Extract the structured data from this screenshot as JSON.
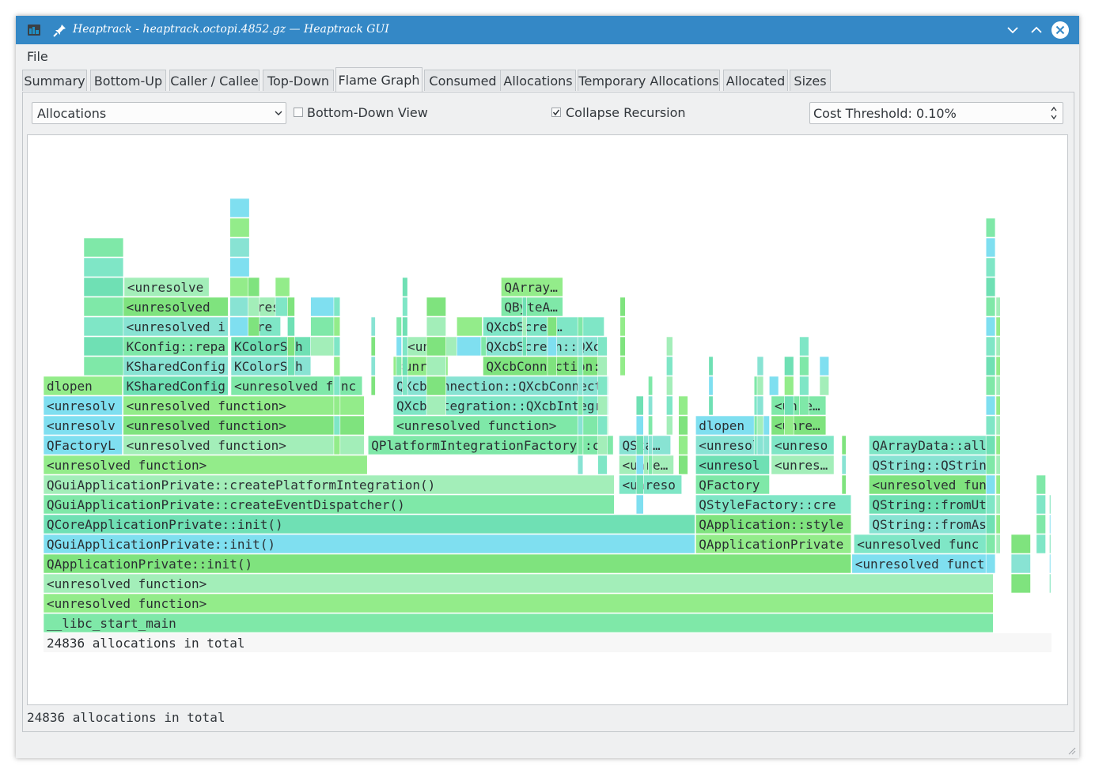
{
  "window": {
    "title": "Heaptrack - heaptrack.octopi.4852.gz — Heaptrack GUI"
  },
  "menu": {
    "file": "File"
  },
  "tabs": [
    {
      "label": "Summary"
    },
    {
      "label": "Bottom-Up"
    },
    {
      "label": "Caller / Callee"
    },
    {
      "label": "Top-Down"
    },
    {
      "label": "Flame Graph",
      "active": true
    },
    {
      "label": "Consumed"
    },
    {
      "label": "Allocations"
    },
    {
      "label": "Temporary Allocations"
    },
    {
      "label": "Allocated"
    },
    {
      "label": "Sizes"
    }
  ],
  "toolbar": {
    "cost_type": "Allocations",
    "bottom_down_label": "Bottom-Down View",
    "bottom_down_checked": false,
    "collapse_label": "Collapse Recursion",
    "collapse_checked": true,
    "threshold": "Cost Threshold: 0.10%"
  },
  "flamegraph": {
    "total_label": "24836 allocations in total",
    "frames": [
      {
        "label": "__libc_start_main",
        "share": 0.943
      },
      {
        "label": "<unresolved function>",
        "share": 0.943
      },
      {
        "label": "<unresolved function>",
        "share": 0.943
      },
      {
        "label": "QApplicationPrivate::init()",
        "share": 0.802
      },
      {
        "label": "QGuiApplicationPrivate::init()",
        "share": 0.647
      },
      {
        "label": "QCoreApplicationPrivate::init()",
        "share": 0.647
      },
      {
        "label": "QGuiApplicationPrivate::createEventDispatcher()",
        "share": 0.567
      },
      {
        "label": "QGuiApplicationPrivate::createPlatformIntegration()",
        "share": 0.567
      },
      {
        "label": "<unresolved function>",
        "share": 0.322
      },
      {
        "label": "QPlatformIntegrationFactory::create",
        "share": 0.244
      },
      {
        "label": "QFactoryL…",
        "share": 0.079
      },
      {
        "label": "<unresolv…",
        "share": 0.079
      },
      {
        "label": "<unresolv…",
        "share": 0.079
      },
      {
        "label": "dlopen",
        "share": 0.079
      },
      {
        "label": "<unresolved function>",
        "share": 0.24
      },
      {
        "label": "<unresolved function>",
        "share": 0.24
      },
      {
        "label": "<unresolved function>",
        "share": 0.24
      },
      {
        "label": "KSharedConfig",
        "share": 0.105
      },
      {
        "label": "KSharedConfig",
        "share": 0.105
      },
      {
        "label": "KConfig::repa",
        "share": 0.105
      },
      {
        "label": "<unresolved i",
        "share": 0.105
      },
      {
        "label": "<unresolved",
        "share": 0.105
      },
      {
        "label": "<unresolve…",
        "share": 0.085
      },
      {
        "label": "<unresolved func",
        "share": 0.131
      },
      {
        "label": "KColorSch…",
        "share": 0.08
      },
      {
        "label": "KColorSch…",
        "share": 0.08
      },
      {
        "label": "<unresol…",
        "share": 0.05
      },
      {
        "label": "<unres…",
        "share": 0.06
      },
      {
        "label": "<unresolved function>",
        "share": 0.214
      },
      {
        "label": "QXcbIntegration::QXcbIntegr",
        "share": 0.214
      },
      {
        "label": "QXcbConnection::QXcbConnect",
        "share": 0.214
      },
      {
        "label": "<unre…",
        "share": 0.055
      },
      {
        "label": "<unr…",
        "share": 0.055
      },
      {
        "label": "QXcbConnection:",
        "share": 0.121
      },
      {
        "label": "QXcbScreen::QXc",
        "share": 0.121
      },
      {
        "label": "QXcbScree…",
        "share": 0.121
      },
      {
        "label": "QByteA…",
        "share": 0.062
      },
      {
        "label": "QArray…",
        "share": 0.062
      },
      {
        "label": "QSta…",
        "share": 0.052
      },
      {
        "label": "<unre…",
        "share": 0.055
      },
      {
        "label": "<unreso…",
        "share": 0.063
      },
      {
        "label": "QApplicationPrivate",
        "share": 0.155
      },
      {
        "label": "QApplication::style",
        "share": 0.155
      },
      {
        "label": "QStyleFactory::cre",
        "share": 0.155
      },
      {
        "label": "QFactory…",
        "share": 0.074
      },
      {
        "label": "<unresol…",
        "share": 0.074
      },
      {
        "label": "<unresol…",
        "share": 0.074
      },
      {
        "label": "dlopen",
        "share": 0.074
      },
      {
        "label": "<unreso…",
        "share": 0.063
      },
      {
        "label": "<unres…",
        "share": 0.063
      },
      {
        "label": "<unre…",
        "share": 0.055
      },
      {
        "label": "<unre…",
        "share": 0.055
      },
      {
        "label": "<unresolved funct:",
        "share": 0.138
      },
      {
        "label": "<unresolved func",
        "share": 0.138
      },
      {
        "label": "QString::fromAs",
        "share": 0.124
      },
      {
        "label": "QString::fromUt",
        "share": 0.124
      },
      {
        "label": "<unresolved fun",
        "share": 0.124
      },
      {
        "label": "QString::QStrin",
        "share": 0.124
      },
      {
        "label": "QArrayData::all",
        "share": 0.124
      }
    ]
  },
  "status": {
    "text": "24836 allocations in total"
  },
  "colors": {
    "titlebar": "#3488c6",
    "window_bg": "#eff0f1",
    "flame_palette": [
      "#7fe8a8",
      "#7fe37e",
      "#7fe6c6",
      "#7fdff0",
      "#93ec8a",
      "#6fe0b4",
      "#a3eeb9",
      "#88e3d3",
      "#62e08e"
    ]
  }
}
